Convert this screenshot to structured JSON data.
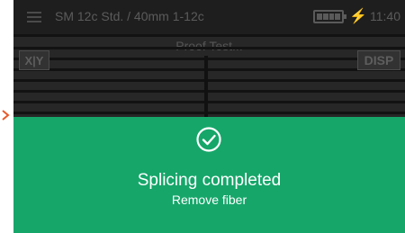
{
  "status_bar": {
    "title": "SM 12c Std. / 40mm 1-12c",
    "time": "11:40",
    "battery_icon": "battery-full-icon",
    "charging_icon": "lightning-bolt-icon"
  },
  "viewer": {
    "title": "Proof Test...",
    "xy_label": "X|Y",
    "disp_label": "DISP"
  },
  "dialog": {
    "icon": "check-circle-icon",
    "title": "Splicing completed",
    "subtitle": "Remove fiber"
  },
  "colors": {
    "success_green": "#16a66a",
    "background": "#2c2c2c",
    "marker": "#e8582a"
  }
}
